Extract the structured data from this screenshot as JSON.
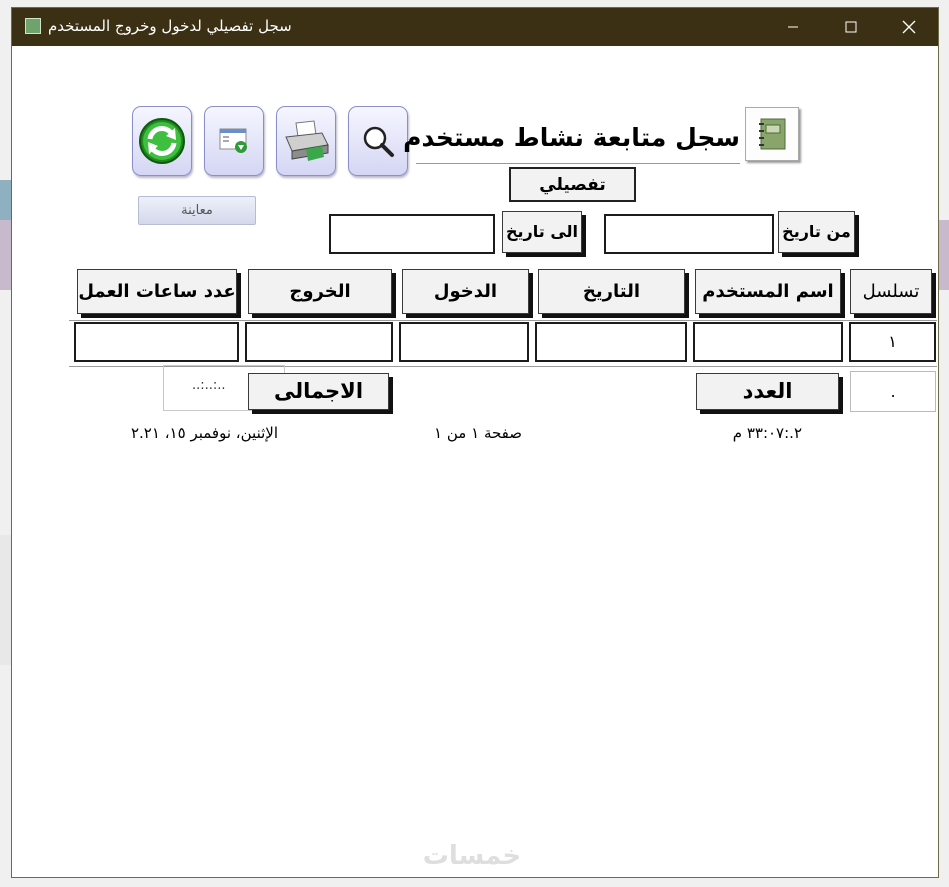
{
  "window": {
    "title": "سجل تفصيلي لدخول وخروج المستخدم"
  },
  "report": {
    "title": "سجل متابعة نشاط مستخدم",
    "subtitle": "تفصيلي",
    "preview_label": "معاينة",
    "from_date_label": "من تاريخ",
    "to_date_label": "الى تاريخ",
    "from_date_value": "",
    "to_date_value": ""
  },
  "table": {
    "columns": [
      "تسلسل",
      "اسم المستخدم",
      "التاريخ",
      "الدخول",
      "الخروج",
      "عدد ساعات العمل"
    ],
    "rows": [
      {
        "seq": "١",
        "user": "",
        "date": "",
        "login": "",
        "logout": "",
        "hours": ""
      }
    ]
  },
  "summary": {
    "count_label": "العدد",
    "count_value": ".",
    "total_label": "الاجمالى",
    "total_value": "..:..:.."
  },
  "footer": {
    "time": "٢.:٣٣:٠٧ م",
    "page": "صفحة ١ من ١",
    "date": "الإثنين، نوفمبر ١٥، ٢.٢١"
  },
  "watermark": "خمسات",
  "colors": {
    "titlebar": "#3b3014",
    "button_gradient_top": "#f6f6ff",
    "button_gradient_bottom": "#d4d6f4",
    "button_border": "#8a8fc8"
  }
}
